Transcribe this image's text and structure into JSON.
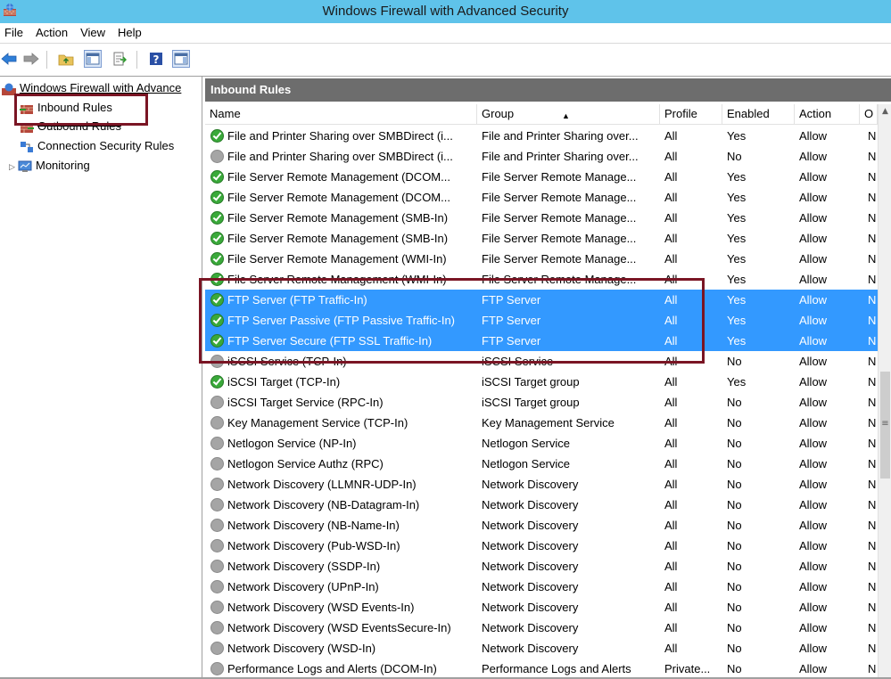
{
  "window": {
    "title": "Windows Firewall with Advanced Security"
  },
  "menu": [
    "File",
    "Action",
    "View",
    "Help"
  ],
  "toolbar": {
    "buttons": [
      "back-icon",
      "forward-icon",
      "up-folder-icon",
      "show-hide-console-tree-icon",
      "export-list-icon",
      "help-icon",
      "show-hide-action-pane-icon"
    ]
  },
  "tree": {
    "root": "Windows Firewall with Advance",
    "items": [
      "Inbound Rules",
      "Outbound Rules",
      "Connection Security Rules",
      "Monitoring"
    ]
  },
  "panel": {
    "title": "Inbound Rules"
  },
  "columns": [
    "Name",
    "Group",
    "Profile",
    "Enabled",
    "Action",
    "O"
  ],
  "rows": [
    {
      "name": "File and Printer Sharing over SMBDirect (i...",
      "group": "File and Printer Sharing over...",
      "profile": "All",
      "enabled": "Yes",
      "action": "Allow",
      "over": "N"
    },
    {
      "name": "File and Printer Sharing over SMBDirect (i...",
      "group": "File and Printer Sharing over...",
      "profile": "All",
      "enabled": "No",
      "action": "Allow",
      "over": "N"
    },
    {
      "name": "File Server Remote Management (DCOM...",
      "group": "File Server Remote Manage...",
      "profile": "All",
      "enabled": "Yes",
      "action": "Allow",
      "over": "N"
    },
    {
      "name": "File Server Remote Management (DCOM...",
      "group": "File Server Remote Manage...",
      "profile": "All",
      "enabled": "Yes",
      "action": "Allow",
      "over": "N"
    },
    {
      "name": "File Server Remote Management (SMB-In)",
      "group": "File Server Remote Manage...",
      "profile": "All",
      "enabled": "Yes",
      "action": "Allow",
      "over": "N"
    },
    {
      "name": "File Server Remote Management (SMB-In)",
      "group": "File Server Remote Manage...",
      "profile": "All",
      "enabled": "Yes",
      "action": "Allow",
      "over": "N"
    },
    {
      "name": "File Server Remote Management (WMI-In)",
      "group": "File Server Remote Manage...",
      "profile": "All",
      "enabled": "Yes",
      "action": "Allow",
      "over": "N"
    },
    {
      "name": "File Server Remote Management (WMI-In)",
      "group": "File Server Remote Manage...",
      "profile": "All",
      "enabled": "Yes",
      "action": "Allow",
      "over": "N"
    },
    {
      "name": "FTP Server (FTP Traffic-In)",
      "group": "FTP Server",
      "profile": "All",
      "enabled": "Yes",
      "action": "Allow",
      "over": "N"
    },
    {
      "name": "FTP Server Passive (FTP Passive Traffic-In)",
      "group": "FTP Server",
      "profile": "All",
      "enabled": "Yes",
      "action": "Allow",
      "over": "N"
    },
    {
      "name": "FTP Server Secure (FTP SSL Traffic-In)",
      "group": "FTP Server",
      "profile": "All",
      "enabled": "Yes",
      "action": "Allow",
      "over": "N"
    },
    {
      "name": "iSCSI Service (TCP-In)",
      "group": "iSCSI Service",
      "profile": "All",
      "enabled": "No",
      "action": "Allow",
      "over": "N"
    },
    {
      "name": "iSCSI Target (TCP-In)",
      "group": "iSCSI Target group",
      "profile": "All",
      "enabled": "Yes",
      "action": "Allow",
      "over": "N"
    },
    {
      "name": "iSCSI Target Service (RPC-In)",
      "group": "iSCSI Target group",
      "profile": "All",
      "enabled": "No",
      "action": "Allow",
      "over": "N"
    },
    {
      "name": "Key Management Service (TCP-In)",
      "group": "Key Management Service",
      "profile": "All",
      "enabled": "No",
      "action": "Allow",
      "over": "N"
    },
    {
      "name": "Netlogon Service (NP-In)",
      "group": "Netlogon Service",
      "profile": "All",
      "enabled": "No",
      "action": "Allow",
      "over": "N"
    },
    {
      "name": "Netlogon Service Authz (RPC)",
      "group": "Netlogon Service",
      "profile": "All",
      "enabled": "No",
      "action": "Allow",
      "over": "N"
    },
    {
      "name": "Network Discovery (LLMNR-UDP-In)",
      "group": "Network Discovery",
      "profile": "All",
      "enabled": "No",
      "action": "Allow",
      "over": "N"
    },
    {
      "name": "Network Discovery (NB-Datagram-In)",
      "group": "Network Discovery",
      "profile": "All",
      "enabled": "No",
      "action": "Allow",
      "over": "N"
    },
    {
      "name": "Network Discovery (NB-Name-In)",
      "group": "Network Discovery",
      "profile": "All",
      "enabled": "No",
      "action": "Allow",
      "over": "N"
    },
    {
      "name": "Network Discovery (Pub-WSD-In)",
      "group": "Network Discovery",
      "profile": "All",
      "enabled": "No",
      "action": "Allow",
      "over": "N"
    },
    {
      "name": "Network Discovery (SSDP-In)",
      "group": "Network Discovery",
      "profile": "All",
      "enabled": "No",
      "action": "Allow",
      "over": "N"
    },
    {
      "name": "Network Discovery (UPnP-In)",
      "group": "Network Discovery",
      "profile": "All",
      "enabled": "No",
      "action": "Allow",
      "over": "N"
    },
    {
      "name": "Network Discovery (WSD Events-In)",
      "group": "Network Discovery",
      "profile": "All",
      "enabled": "No",
      "action": "Allow",
      "over": "N"
    },
    {
      "name": "Network Discovery (WSD EventsSecure-In)",
      "group": "Network Discovery",
      "profile": "All",
      "enabled": "No",
      "action": "Allow",
      "over": "N"
    },
    {
      "name": "Network Discovery (WSD-In)",
      "group": "Network Discovery",
      "profile": "All",
      "enabled": "No",
      "action": "Allow",
      "over": "N"
    },
    {
      "name": "Performance Logs and Alerts (DCOM-In)",
      "group": "Performance Logs and Alerts",
      "profile": "Private...",
      "enabled": "No",
      "action": "Allow",
      "over": "N"
    }
  ],
  "selected_rows": [
    8,
    9,
    10
  ],
  "colors": {
    "title_bar": "#5fc3ea",
    "selection": "#3399ff",
    "panel_header": "#6d6d6d",
    "annotation_box": "#7a1524"
  }
}
